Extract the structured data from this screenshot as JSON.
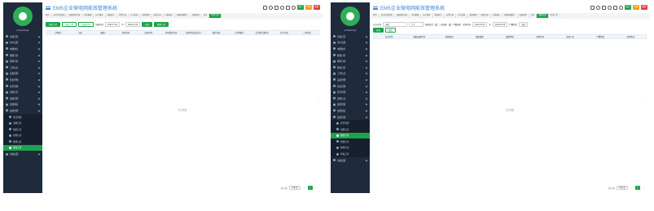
{
  "app": {
    "title": "EMS企业微电网能效管理系统",
    "logo_text": "A003",
    "username": "pcstatutoragi",
    "colors": {
      "sidebar_bg": "#1f2a3c",
      "accent_green": "#1ca34c",
      "title_blue": "#3c80d8",
      "badge_green": "#1ca34c",
      "badge_orange": "#f39c12",
      "badge_red": "#e53935"
    },
    "top_icons": [
      "print-icon",
      "search-icon",
      "share-icon",
      "fullscreen-icon",
      "grid-icon",
      "bell-icon"
    ],
    "top_badges": [
      {
        "text": "运行",
        "color": "#1ca34c"
      },
      {
        "text": "告警",
        "color": "#f39c12"
      },
      {
        "text": "故障",
        "color": "#e53935"
      }
    ]
  },
  "left": {
    "menu": [
      {
        "label": "系统首页",
        "icon": "home-icon",
        "type": "main"
      },
      {
        "label": "用户设置",
        "icon": "user-icon",
        "type": "main"
      },
      {
        "label": "电能统计",
        "icon": "chart-icon",
        "type": "main"
      },
      {
        "label": "数据分析",
        "icon": "analysis-icon",
        "type": "main"
      },
      {
        "label": "能耗分析",
        "icon": "energy-icon",
        "type": "main"
      },
      {
        "label": "工单信息",
        "icon": "order-icon",
        "type": "main"
      },
      {
        "label": "设备管理",
        "icon": "device-icon",
        "type": "main"
      },
      {
        "label": "隐患管理",
        "icon": "warning-icon",
        "type": "main"
      },
      {
        "label": "任务管理",
        "icon": "task-icon",
        "type": "main"
      },
      {
        "label": "巡检记录",
        "icon": "patrol-icon",
        "type": "main"
      },
      {
        "label": "运维管理",
        "icon": "ops-icon",
        "type": "main"
      },
      {
        "label": "运维报表",
        "icon": "report-icon",
        "type": "main"
      },
      {
        "label": "运维管理",
        "icon": "ops-icon",
        "type": "main"
      },
      {
        "label": "任务管理",
        "icon": "task-icon",
        "type": "sub"
      },
      {
        "label": "巡检记录",
        "icon": "dot-icon",
        "type": "sub"
      },
      {
        "label": "缺陷记录",
        "icon": "dot-icon",
        "type": "sub"
      },
      {
        "label": "抢修记录",
        "icon": "dot-icon",
        "type": "sub"
      },
      {
        "label": "维修记录",
        "icon": "dot-icon",
        "type": "sub"
      },
      {
        "label": "停电工单",
        "icon": "dot-icon",
        "type": "sub-active"
      },
      {
        "label": "系统设置",
        "icon": "gear-icon",
        "type": "main"
      }
    ],
    "tabs": [
      "首页",
      "运行状态监测",
      "设备档案信息",
      "实时数据",
      "运行报表",
      "能耗统计",
      "告警记录",
      "日志查询",
      "运维管理",
      "巡检记录",
      "分析报告",
      "电能质量统计",
      "运维班组",
      "任务",
      "停电工单"
    ],
    "active_tab": 14,
    "buttons": [
      "新增工单",
      "导出工单",
      "导出Excel"
    ],
    "date_label": "创建时间",
    "date_start": "2022-07-01",
    "date_sep": "至",
    "date_end": "2022-07-08",
    "search_btn": "查询",
    "reset_btn": "重置工单",
    "columns": [
      "工单编号",
      "站名",
      "创建人",
      "停电时间",
      "送电时间",
      "停电检修内容",
      "检修单位及负责人",
      "操作内容",
      "工作票编号",
      "工作票完成时间",
      "执行状态",
      "工单状态"
    ],
    "no_data": "暂无数据",
    "pager": {
      "total": "共 0 条",
      "page_size": "10条/页",
      "prev": "‹",
      "current": "1",
      "next": "›"
    }
  },
  "right": {
    "menu": [
      {
        "label": "系统首页",
        "icon": "home-icon",
        "type": "main"
      },
      {
        "label": "用户设置",
        "icon": "user-icon",
        "type": "main"
      },
      {
        "label": "电能统计",
        "icon": "chart-icon",
        "type": "main"
      },
      {
        "label": "数据分析",
        "icon": "analysis-icon",
        "type": "main"
      },
      {
        "label": "能耗分析",
        "icon": "energy-icon",
        "type": "main"
      },
      {
        "label": "能效分析",
        "icon": "efficiency-icon",
        "type": "main"
      },
      {
        "label": "工单信息",
        "icon": "order-icon",
        "type": "main"
      },
      {
        "label": "设备管理",
        "icon": "device-icon",
        "type": "main"
      },
      {
        "label": "隐患管理",
        "icon": "warning-icon",
        "type": "main"
      },
      {
        "label": "任务管理",
        "icon": "task-icon",
        "type": "main"
      },
      {
        "label": "巡检记录",
        "icon": "patrol-icon",
        "type": "main"
      },
      {
        "label": "运维管理",
        "icon": "ops-icon",
        "type": "main"
      },
      {
        "label": "运维报表",
        "icon": "report-icon",
        "type": "main"
      },
      {
        "label": "运维管理",
        "icon": "ops-icon",
        "type": "main"
      },
      {
        "label": "任务管理",
        "icon": "task-icon",
        "type": "sub"
      },
      {
        "label": "巡检记录",
        "icon": "dot-icon",
        "type": "sub"
      },
      {
        "label": "缺陷记录",
        "icon": "dot-icon",
        "type": "sub-active"
      },
      {
        "label": "抢修记录",
        "icon": "dot-icon",
        "type": "sub"
      },
      {
        "label": "维修记录",
        "icon": "dot-icon",
        "type": "sub"
      },
      {
        "label": "停电工单",
        "icon": "dot-icon",
        "type": "sub"
      },
      {
        "label": "系统设置",
        "icon": "gear-icon",
        "type": "main"
      }
    ],
    "tabs": [
      "首页",
      "运行状态监测",
      "设备档案信息",
      "实时数据",
      "运行报表",
      "能耗统计",
      "告警记录",
      "日志查询",
      "运维管理",
      "巡检记录",
      "分析报告",
      "电能质量统计",
      "运维班组",
      "任务",
      "缺陷记录",
      "停电工单"
    ],
    "active_tab": 14,
    "site_label": "站点名称",
    "site_value": "全部",
    "search_placeholder": "搜索",
    "type_label": "缺陷类型",
    "type_options": [
      "一般缺陷",
      "严重缺陷"
    ],
    "date_label": "发现时间",
    "date_start": "2022-07-01",
    "date_sep": "至",
    "date_end": "2022-07-08",
    "level_label": "严重程度",
    "level_value": "全部",
    "search_btn": "查询",
    "reset_btn": "重置",
    "columns": [
      "站点名称",
      "缺陷设备名称",
      "缺陷类型",
      "缺陷描述",
      "缺陷等级",
      "发现时间",
      "发现人员",
      "严重程度",
      "处理状态"
    ],
    "no_data": "暂无数据",
    "pager": {
      "total": "共 0 条",
      "page_size": "10条/页",
      "prev": "‹",
      "current": "1",
      "next": "›"
    }
  }
}
